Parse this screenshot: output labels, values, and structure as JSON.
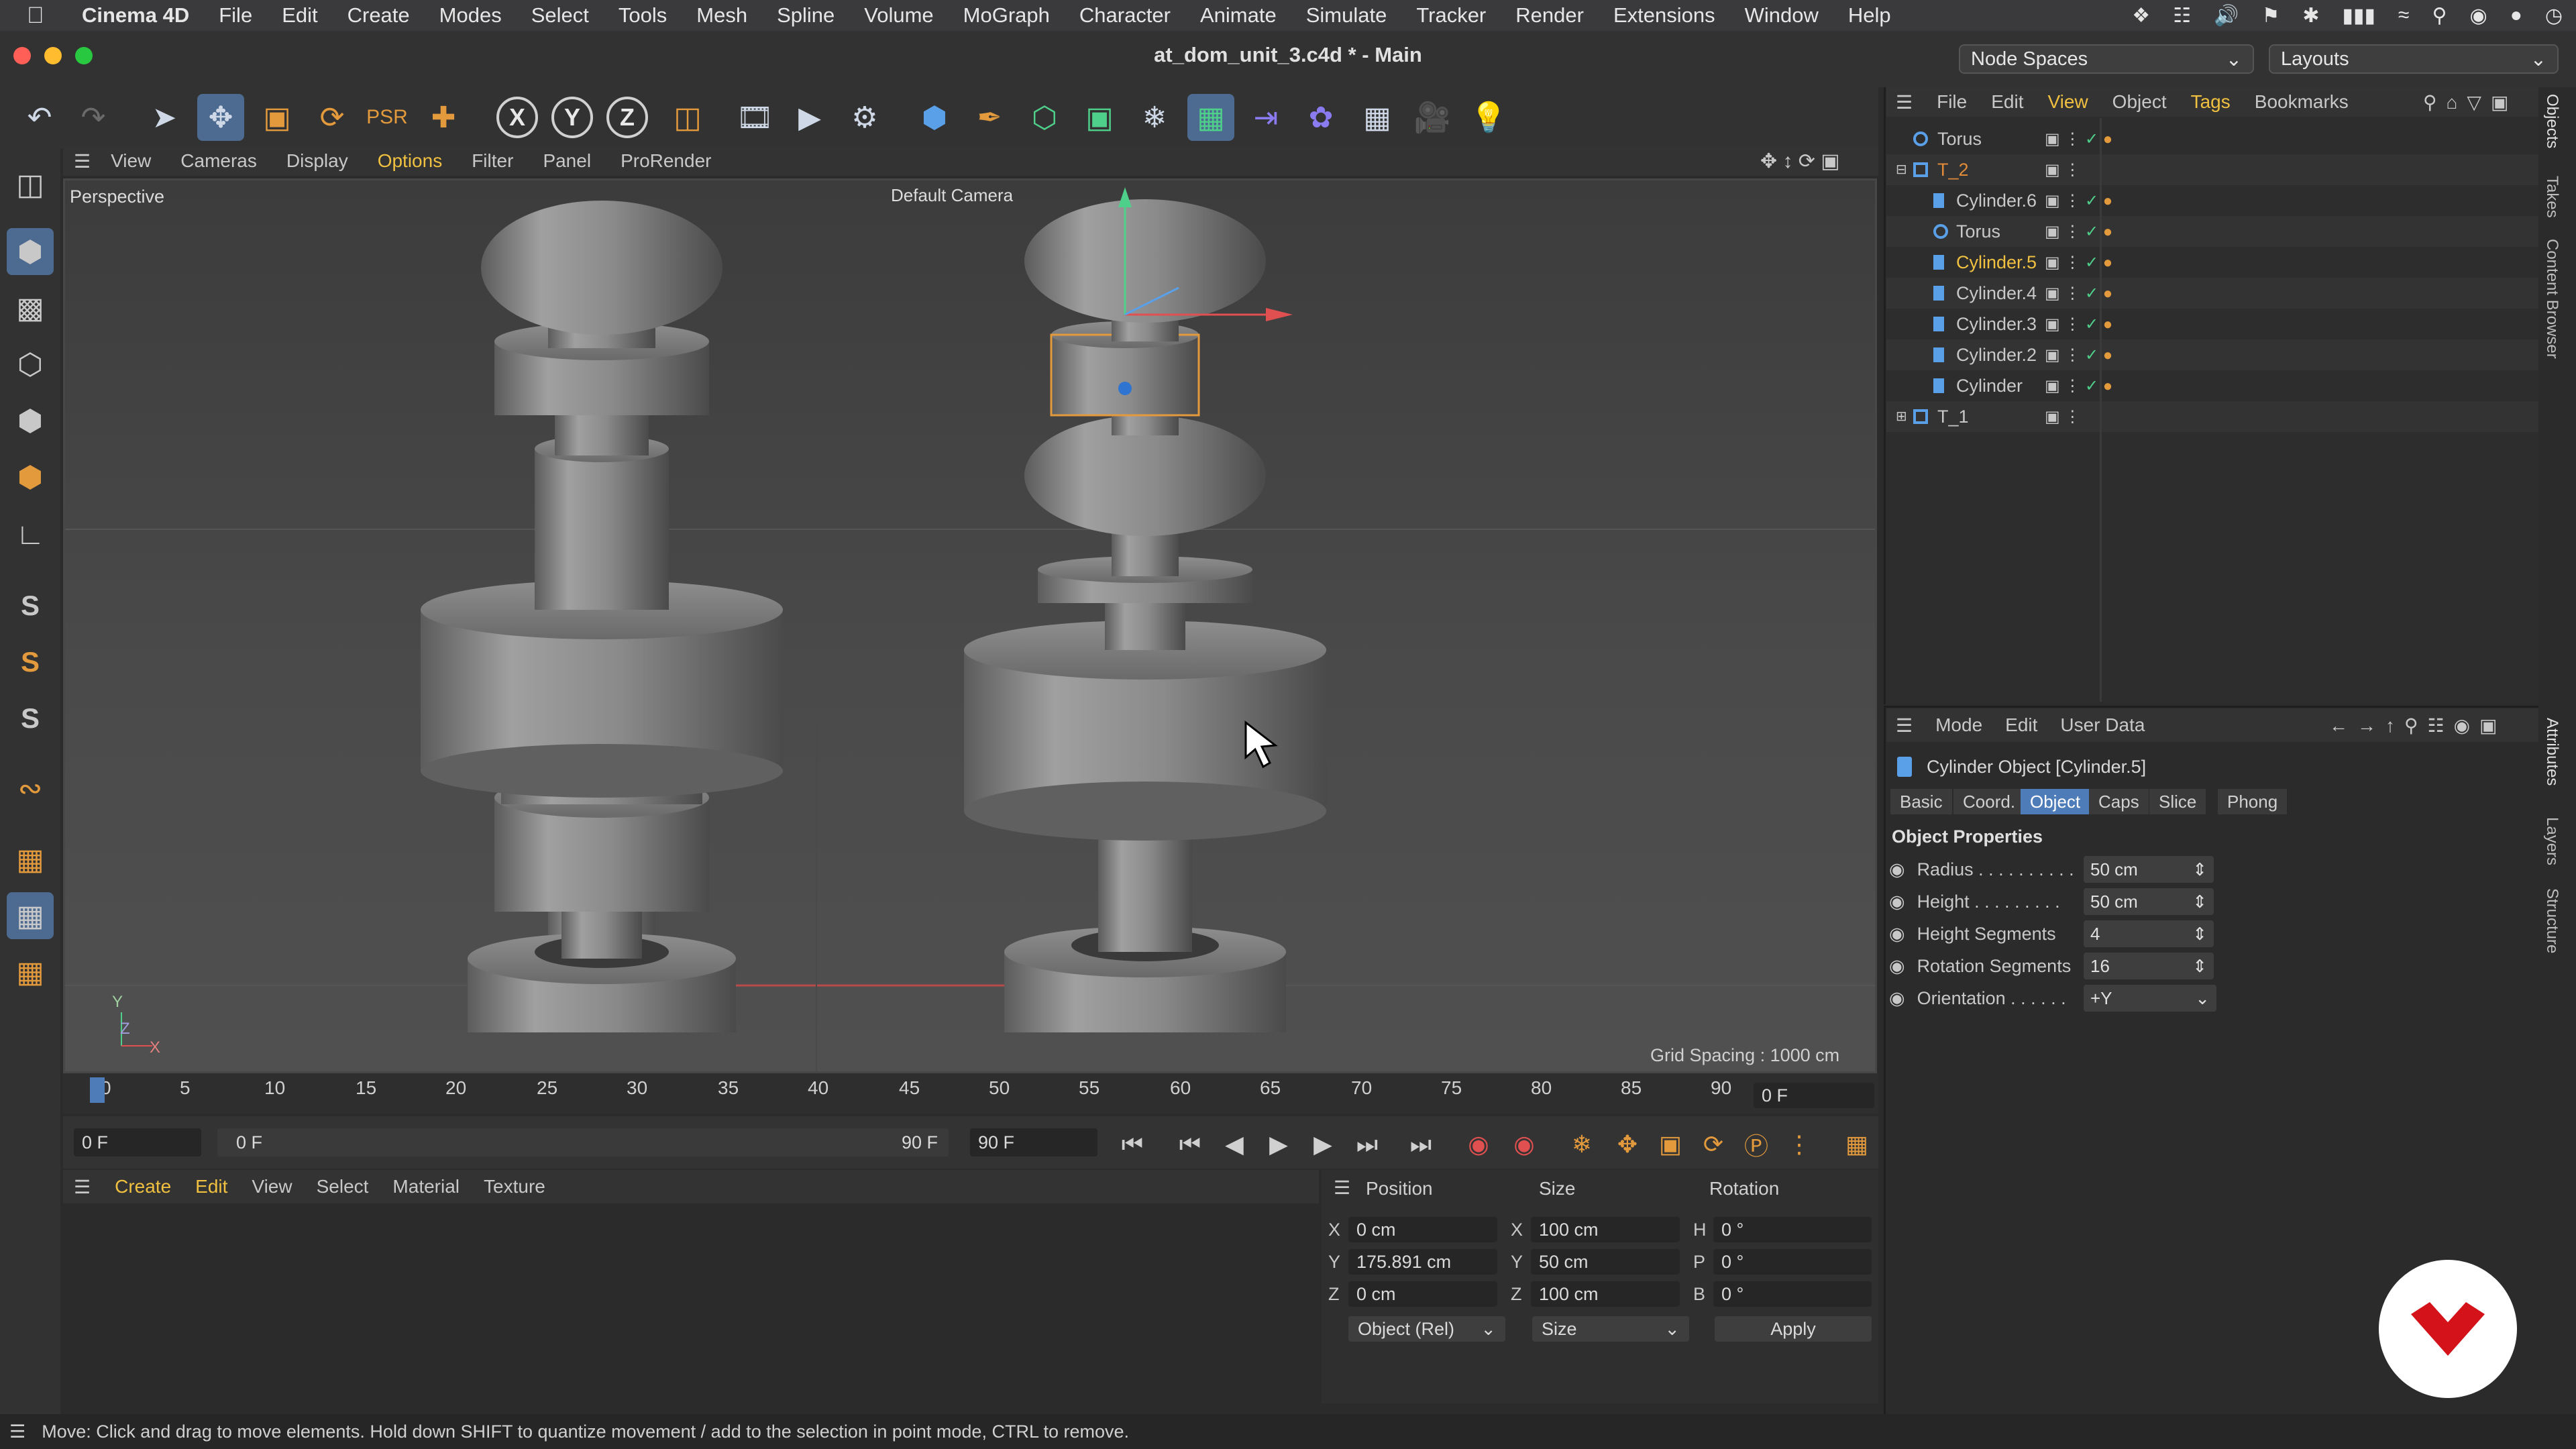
{
  "menubar": {
    "app": "Cinema 4D",
    "items": [
      "File",
      "Edit",
      "Create",
      "Modes",
      "Select",
      "Tools",
      "Mesh",
      "Spline",
      "Volume",
      "MoGraph",
      "Character",
      "Animate",
      "Simulate",
      "Tracker",
      "Render",
      "Extensions",
      "Window",
      "Help"
    ]
  },
  "window": {
    "title": "at_dom_unit_3.c4d * - Main",
    "node_spaces": "Node Spaces",
    "layouts": "Layouts"
  },
  "viewport": {
    "menu": [
      "View",
      "Cameras",
      "Display",
      "Options",
      "Filter",
      "Panel",
      "ProRender"
    ],
    "label": "Perspective",
    "camera": "Default Camera",
    "grid_spacing": "Grid Spacing : 1000 cm",
    "axis_labels": {
      "y": "Y",
      "z": "Z",
      "x": "X"
    }
  },
  "timeline": {
    "ticks": [
      "0",
      "5",
      "10",
      "15",
      "20",
      "25",
      "30",
      "35",
      "40",
      "45",
      "50",
      "55",
      "60",
      "65",
      "70",
      "75",
      "80",
      "85",
      "90"
    ],
    "current_frame": "0 F",
    "start_field": "0 F",
    "range_start": "0 F",
    "range_end": "90 F",
    "end_field": "90 F"
  },
  "material_manager": {
    "menu": [
      "Create",
      "Edit",
      "View",
      "Select",
      "Material",
      "Texture"
    ]
  },
  "coordinates": {
    "headers": [
      "Position",
      "Size",
      "Rotation"
    ],
    "rows": [
      {
        "axis": "X",
        "pos": "0 cm",
        "size_axis": "X",
        "size": "100 cm",
        "rot_axis": "H",
        "rot": "0 °"
      },
      {
        "axis": "Y",
        "pos": "175.891 cm",
        "size_axis": "Y",
        "size": "50 cm",
        "rot_axis": "P",
        "rot": "0 °"
      },
      {
        "axis": "Z",
        "pos": "0 cm",
        "size_axis": "Z",
        "size": "100 cm",
        "rot_axis": "B",
        "rot": "0 °"
      }
    ],
    "mode": "Object (Rel)",
    "size_mode": "Size",
    "apply": "Apply"
  },
  "status": "Move: Click and drag to move elements. Hold down SHIFT to quantize movement / add to the selection in point mode, CTRL to remove.",
  "object_manager": {
    "menu": [
      "File",
      "Edit",
      "View",
      "Object",
      "Tags",
      "Bookmarks"
    ],
    "items": [
      {
        "name": "Torus"
      },
      {
        "name": "T_2"
      },
      {
        "name": "Cylinder.6"
      },
      {
        "name": "Torus"
      },
      {
        "name": "Cylinder.5"
      },
      {
        "name": "Cylinder.4"
      },
      {
        "name": "Cylinder.3"
      },
      {
        "name": "Cylinder.2"
      },
      {
        "name": "Cylinder"
      },
      {
        "name": "T_1"
      }
    ]
  },
  "attributes": {
    "menu": [
      "Mode",
      "Edit",
      "User Data"
    ],
    "object_title": "Cylinder Object [Cylinder.5]",
    "tabs": [
      "Basic",
      "Coord.",
      "Object",
      "Caps",
      "Slice",
      "Phong"
    ],
    "active_tab": "Object",
    "section": "Object Properties",
    "props": [
      {
        "label": "Radius . . . . . . . . . .",
        "value": "50 cm"
      },
      {
        "label": "Height . . . . . . . . .",
        "value": "50 cm"
      },
      {
        "label": "Height Segments",
        "value": "4"
      },
      {
        "label": "Rotation Segments",
        "value": "16"
      },
      {
        "label": "Orientation . . . . . .",
        "value": "+Y"
      }
    ]
  },
  "side_tabs": {
    "top": [
      "Objects",
      "Takes",
      "Content Browser"
    ],
    "bottom": [
      "Attributes",
      "Layers",
      "Structure"
    ]
  },
  "colors": {
    "accent": "#4e7cb8",
    "selected_object": "#f0c040",
    "selected_label": "#e08a3a"
  }
}
